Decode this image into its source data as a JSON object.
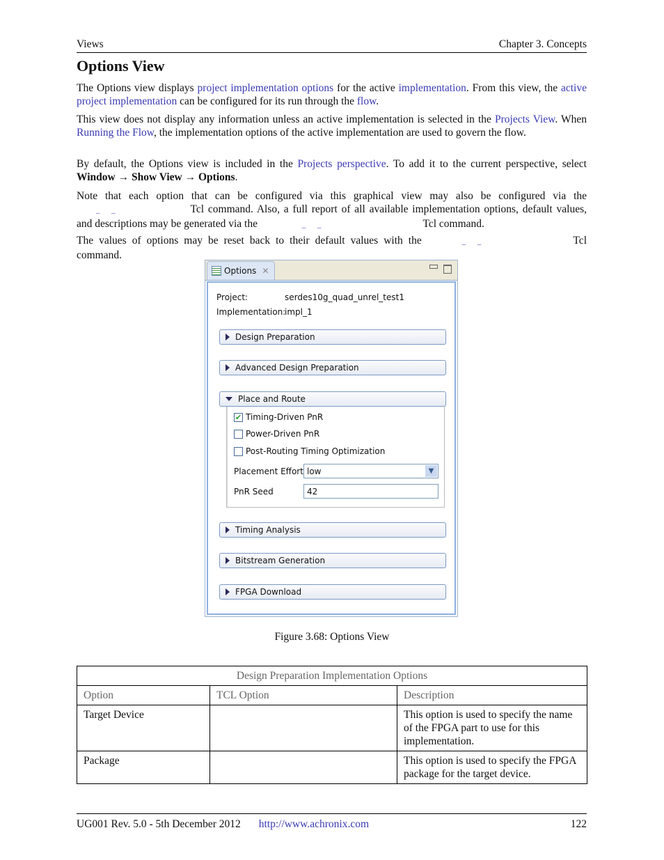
{
  "header": {
    "left": "Views",
    "right": "Chapter 3. Concepts"
  },
  "title": "Options View",
  "para1": {
    "t1": "The Options view displays ",
    "l1": "project implementation options",
    "t2": " for the active ",
    "l2": "implementation",
    "t3": ". From this view, the ",
    "l3": "active project implementation",
    "t4": " can be configured for its run through the ",
    "l4": "flow",
    "t5": "."
  },
  "para2": {
    "t1": "This view does not display any information unless an active implementation is selected in the ",
    "l1": "Projects View",
    "t2": ". When ",
    "l2": "Running the Flow",
    "t3": ", the implementation options of the active implementation are used to govern the flow."
  },
  "para3": {
    "t1": "By default, the Options view is included in the ",
    "l1": "Projects perspective",
    "t2": ". To add it to the current perspective, select ",
    "b1": "Window",
    "arrow": " → ",
    "b2": "Show View",
    "b3": "Options",
    "t3": "."
  },
  "para4": {
    "t1": "Note that each option that can be configured via this graphical view may also be configured via the ",
    "gap": "_      _",
    "t2": " Tcl command. Also, a full report of all available implementation options, default values, and descriptions may be generated via the ",
    "t3": " Tcl command."
  },
  "para5": {
    "t1": "The values of options may be reset back to their default values with the ",
    "gap": "_      _",
    "t2": " Tcl command."
  },
  "options_view": {
    "tab_label": "Options",
    "project_label": "Project:",
    "project_value": "serdes10g_quad_unrel_test1",
    "impl_label": "Implementation:",
    "impl_value": "impl_1",
    "sections": [
      "Design Preparation",
      "Advanced Design Preparation",
      "Place and Route",
      "Timing Analysis",
      "Bitstream Generation",
      "FPGA Download"
    ],
    "place_and_route": {
      "checkboxes": [
        {
          "label": "Timing-Driven PnR",
          "checked": true
        },
        {
          "label": "Power-Driven PnR",
          "checked": false
        },
        {
          "label": "Post-Routing Timing Optimization",
          "checked": false
        }
      ],
      "placement_effort_label": "Placement Effort",
      "placement_effort_value": "low",
      "pnr_seed_label": "PnR Seed",
      "pnr_seed_value": "42"
    }
  },
  "caption": "Figure 3.68: Options View",
  "table": {
    "title": "Design Preparation Implementation Options",
    "headers": [
      "Option",
      "TCL Option",
      "Description"
    ],
    "rows": [
      [
        "Target Device",
        "",
        "This option is used to specify the name of the FPGA part to use for this implementation."
      ],
      [
        "Package",
        "",
        "This option is used to specify the FPGA package for the target device."
      ]
    ]
  },
  "footer": {
    "left": "UG001 Rev. 5.0 - 5th December 2012",
    "link": "http://www.achronix.com",
    "page": "122"
  }
}
